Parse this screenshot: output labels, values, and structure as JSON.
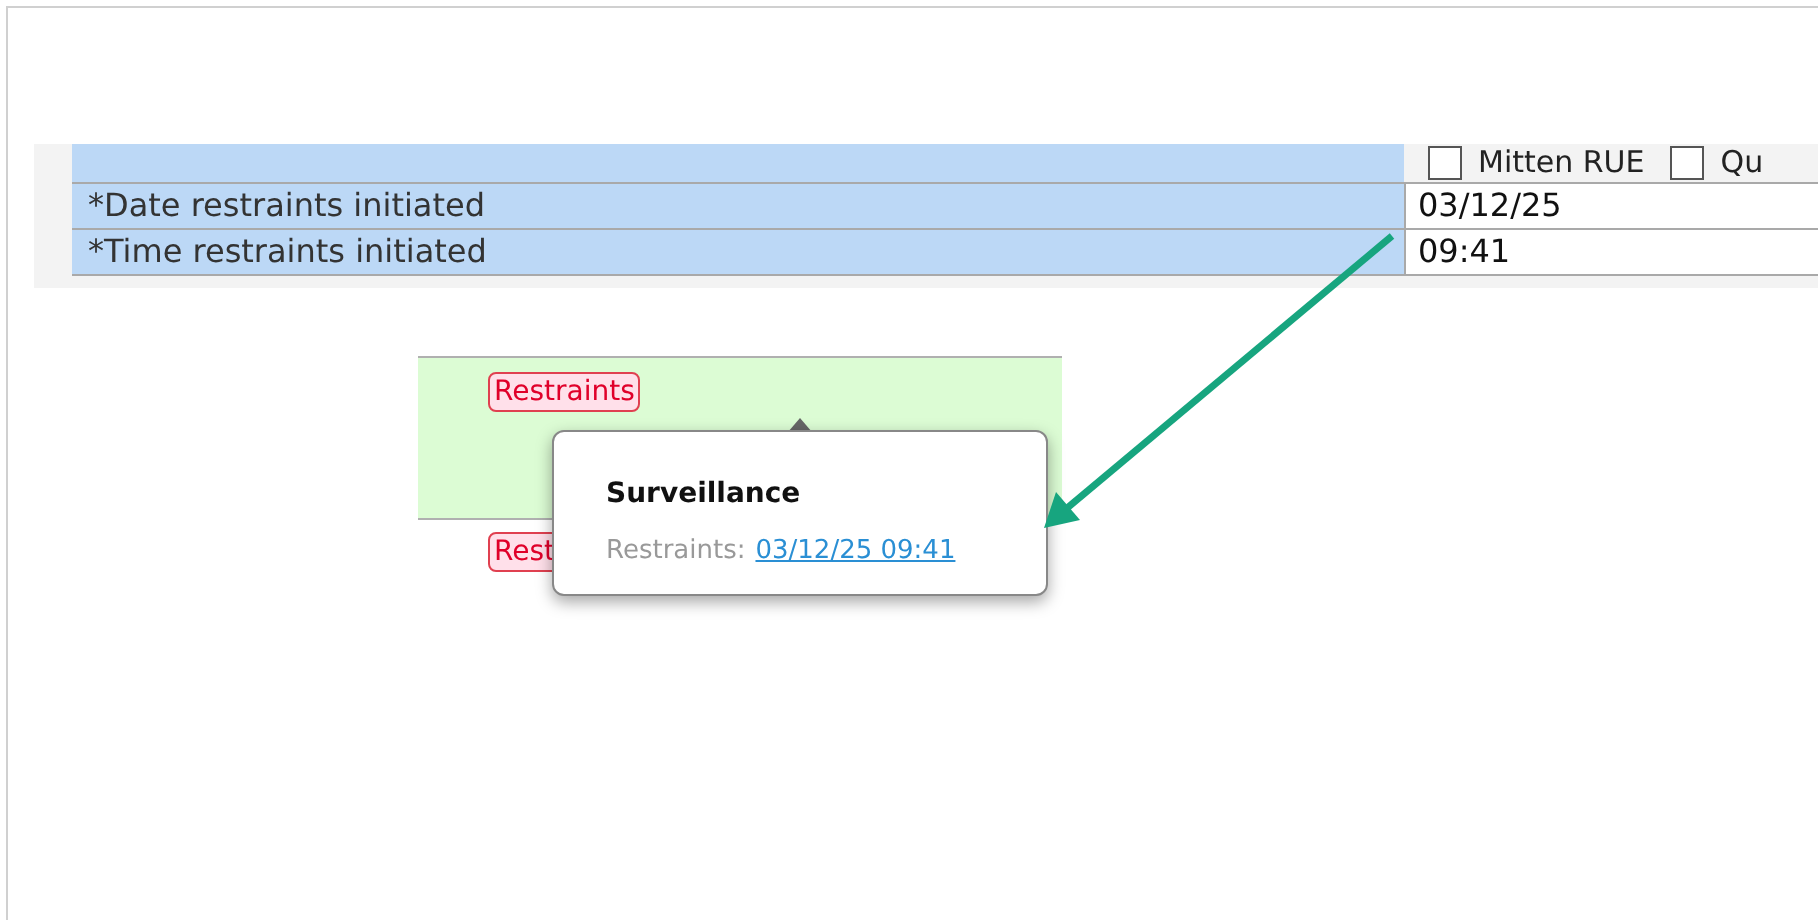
{
  "form": {
    "checkboxes": [
      {
        "label": "Mitten RUE",
        "checked": false
      },
      {
        "label": "Qu",
        "checked": false
      }
    ],
    "rows": [
      {
        "label": "*Date restraints initiated",
        "value": "03/12/25"
      },
      {
        "label": "*Time restraints initiated",
        "value": "09:41"
      }
    ]
  },
  "panel": {
    "tags": [
      "Restraints",
      "Rest"
    ]
  },
  "popover": {
    "title": "Surveillance",
    "label": "Restraints:",
    "link": "03/12/25 09:41"
  }
}
